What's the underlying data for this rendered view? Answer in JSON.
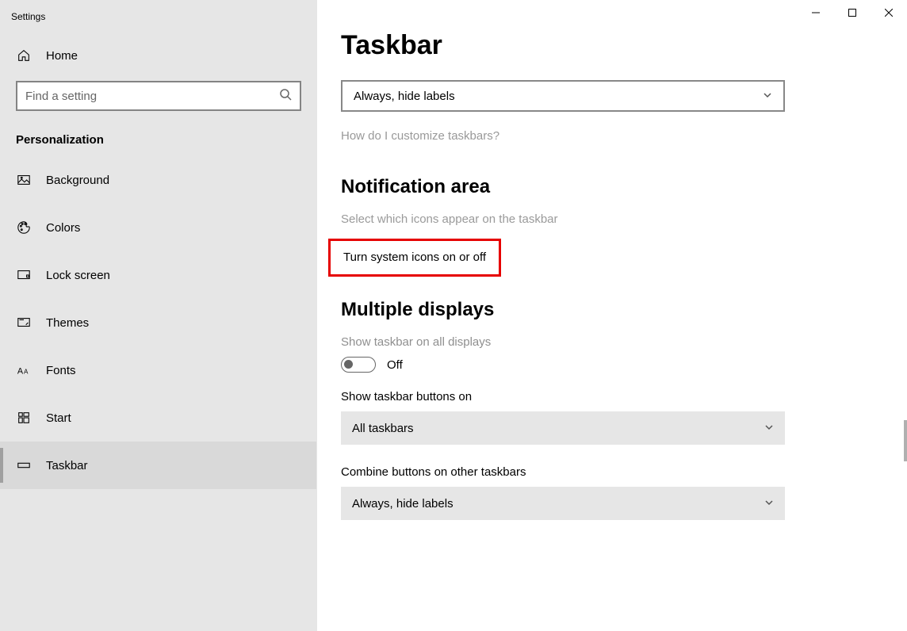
{
  "window": {
    "title": "Settings"
  },
  "sidebar": {
    "home_label": "Home",
    "search_placeholder": "Find a setting",
    "section": "Personalization",
    "items": [
      {
        "label": "Background"
      },
      {
        "label": "Colors"
      },
      {
        "label": "Lock screen"
      },
      {
        "label": "Themes"
      },
      {
        "label": "Fonts"
      },
      {
        "label": "Start"
      },
      {
        "label": "Taskbar"
      }
    ]
  },
  "main": {
    "title": "Taskbar",
    "combine_dropdown_value": "Always, hide labels",
    "help_link": "How do I customize taskbars?",
    "notification": {
      "heading": "Notification area",
      "select_icons_link": "Select which icons appear on the taskbar",
      "system_icons_link": "Turn system icons on or off"
    },
    "multiple_displays": {
      "heading": "Multiple displays",
      "show_on_all_label": "Show taskbar on all displays",
      "show_on_all_value": "Off",
      "show_buttons_label": "Show taskbar buttons on",
      "show_buttons_value": "All taskbars",
      "combine_other_label": "Combine buttons on other taskbars",
      "combine_other_value": "Always, hide labels"
    }
  }
}
